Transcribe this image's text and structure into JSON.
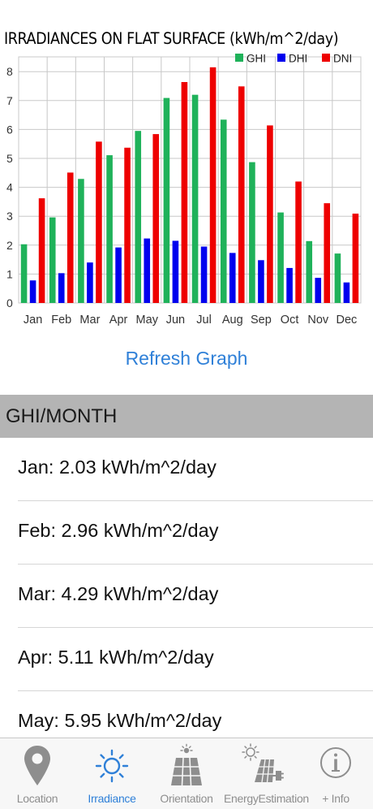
{
  "chart_data": {
    "type": "bar",
    "title": "IRRADIANCES ON FLAT SURFACE (kWh/m^2/day)",
    "categories": [
      "Jan",
      "Feb",
      "Mar",
      "Apr",
      "May",
      "Jun",
      "Jul",
      "Aug",
      "Sep",
      "Oct",
      "Nov",
      "Dec"
    ],
    "series": [
      {
        "name": "GHI",
        "color": "#1fb25a",
        "values": [
          2.03,
          2.96,
          4.29,
          5.11,
          5.95,
          7.09,
          7.2,
          6.34,
          4.87,
          3.13,
          2.14,
          1.71
        ]
      },
      {
        "name": "DHI",
        "color": "#0000ee",
        "values": [
          0.78,
          1.03,
          1.4,
          1.92,
          2.23,
          2.15,
          1.95,
          1.73,
          1.48,
          1.21,
          0.87,
          0.71
        ]
      },
      {
        "name": "DNI",
        "color": "#ee0000",
        "values": [
          3.62,
          4.51,
          5.58,
          5.37,
          5.84,
          7.64,
          8.15,
          7.49,
          6.14,
          4.2,
          3.45,
          3.09
        ]
      }
    ],
    "ylim": [
      0,
      8.2
    ],
    "yticks": [
      "0",
      "1",
      "2",
      "3",
      "4",
      "5",
      "6",
      "7",
      "8"
    ],
    "grid": true,
    "legend_position": "top-right"
  },
  "refresh_label": "Refresh Graph",
  "section_title": "GHI/MONTH",
  "monthly_ghi": [
    "Jan: 2.03 kWh/m^2/day",
    "Feb: 2.96 kWh/m^2/day",
    "Mar: 4.29 kWh/m^2/day",
    "Apr: 5.11 kWh/m^2/day",
    "May: 5.95 kWh/m^2/day"
  ],
  "tabs": [
    {
      "label": "Location",
      "icon": "location-pin-icon",
      "active": false
    },
    {
      "label": "Irradiance",
      "icon": "sun-icon",
      "active": true
    },
    {
      "label": "Orientation",
      "icon": "solar-panel-icon",
      "active": false
    },
    {
      "label": "EnergyEstimation",
      "icon": "solar-panel-plug-icon",
      "active": false
    },
    {
      "label": "+ Info",
      "icon": "info-icon",
      "active": false
    }
  ],
  "colors": {
    "accent": "#2f80d8",
    "section_header_bg": "#b4b4b4",
    "inactive_tab": "#8e8e8e"
  }
}
